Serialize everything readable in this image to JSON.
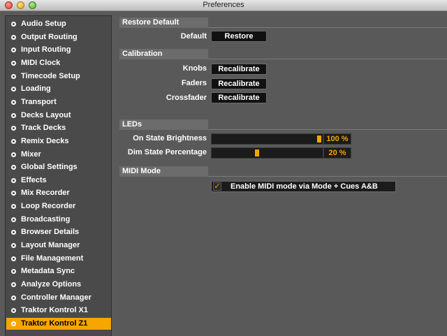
{
  "window": {
    "title": "Preferences"
  },
  "sidebar": {
    "items": [
      {
        "label": "Audio Setup",
        "active": false
      },
      {
        "label": "Output Routing",
        "active": false
      },
      {
        "label": "Input Routing",
        "active": false
      },
      {
        "label": "MIDI Clock",
        "active": false
      },
      {
        "label": "Timecode Setup",
        "active": false
      },
      {
        "label": "Loading",
        "active": false
      },
      {
        "label": "Transport",
        "active": false
      },
      {
        "label": "Decks Layout",
        "active": false
      },
      {
        "label": "Track Decks",
        "active": false
      },
      {
        "label": "Remix Decks",
        "active": false
      },
      {
        "label": "Mixer",
        "active": false
      },
      {
        "label": "Global Settings",
        "active": false
      },
      {
        "label": "Effects",
        "active": false
      },
      {
        "label": "Mix Recorder",
        "active": false
      },
      {
        "label": "Loop Recorder",
        "active": false
      },
      {
        "label": "Broadcasting",
        "active": false
      },
      {
        "label": "Browser Details",
        "active": false
      },
      {
        "label": "Layout Manager",
        "active": false
      },
      {
        "label": "File Management",
        "active": false
      },
      {
        "label": "Metadata Sync",
        "active": false
      },
      {
        "label": "Analyze Options",
        "active": false
      },
      {
        "label": "Controller Manager",
        "active": false
      },
      {
        "label": "Traktor Kontrol X1",
        "active": false
      },
      {
        "label": "Traktor Kontrol Z1",
        "active": true
      }
    ]
  },
  "restore": {
    "header": "Restore Default",
    "default_label": "Default",
    "restore_button": "Restore"
  },
  "calibration": {
    "header": "Calibration",
    "knobs_label": "Knobs",
    "faders_label": "Faders",
    "crossfader_label": "Crossfader",
    "recalibrate_button": "Recalibrate"
  },
  "leds": {
    "header": "LEDs",
    "on_state_label": "On State Brightness",
    "on_state_value": "100 %",
    "on_state_fraction": 1.0,
    "dim_state_label": "Dim State Percentage",
    "dim_state_value": "20 %",
    "dim_state_fraction": 0.4
  },
  "midi": {
    "header": "MIDI Mode",
    "checkbox_label": "Enable MIDI mode via Mode + Cues A&B",
    "checked": true
  },
  "colors": {
    "accent": "#f7a500",
    "panel": "#595959",
    "sidebar": "#4a4a4a"
  }
}
